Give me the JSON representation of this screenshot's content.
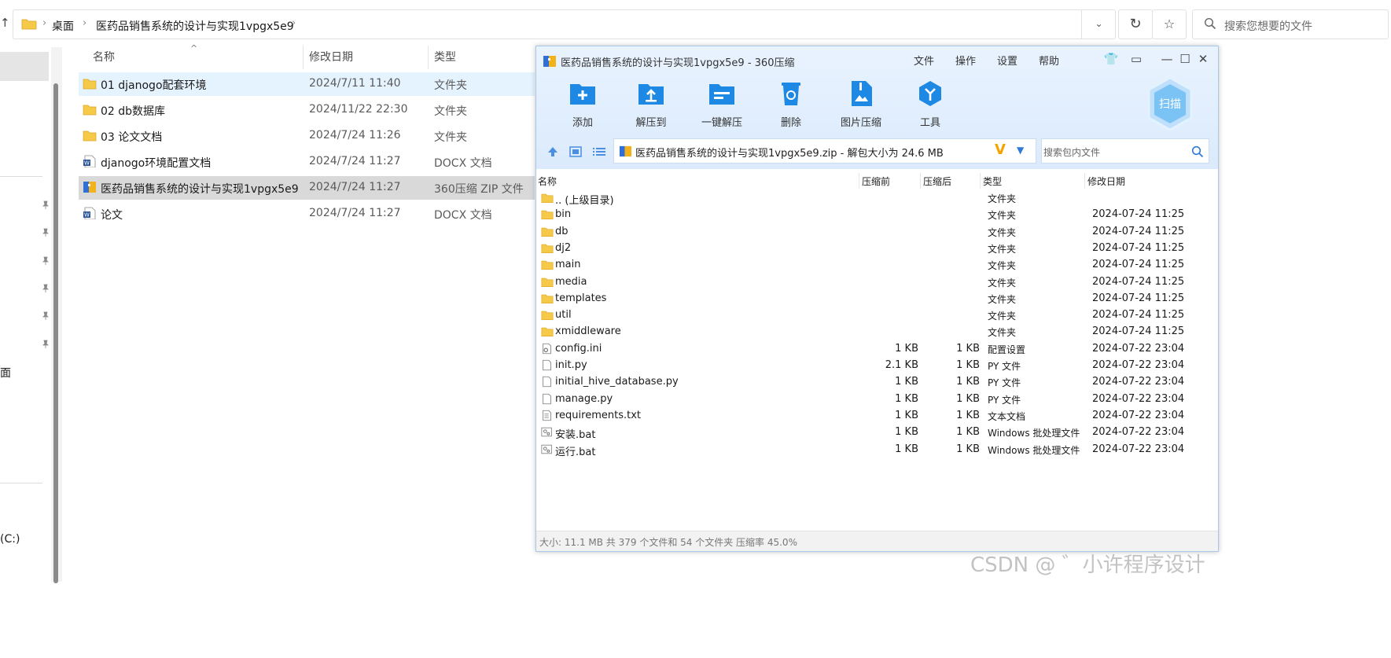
{
  "explorer": {
    "breadcrumb": [
      "桌面",
      "医药品销售系统的设计与实现1vpgx5e9"
    ],
    "search_placeholder": "搜索您想要的文件",
    "nav": {
      "item_desktop": "面",
      "item_drive": "(C:)"
    },
    "columns": {
      "name": "名称",
      "modified": "修改日期",
      "type": "类型"
    },
    "files": [
      {
        "name": "01 djanogo配套环境",
        "modified": "2024/7/11 11:40",
        "type": "文件夹",
        "icon": "folder-icon",
        "state": "hover"
      },
      {
        "name": "02 db数据库",
        "modified": "2024/11/22 22:30",
        "type": "文件夹",
        "icon": "folder-icon",
        "state": ""
      },
      {
        "name": "03 论文文档",
        "modified": "2024/7/24 11:26",
        "type": "文件夹",
        "icon": "folder-icon",
        "state": ""
      },
      {
        "name": "djanogo环境配置文档",
        "modified": "2024/7/24 11:27",
        "type": "DOCX 文档",
        "icon": "word-doc-icon",
        "state": ""
      },
      {
        "name": "医药品销售系统的设计与实现1vpgx5e9",
        "modified": "2024/7/24 11:27",
        "type": "360压缩 ZIP 文件",
        "icon": "zip-archive-icon",
        "state": "selected"
      },
      {
        "name": "论文",
        "modified": "2024/7/24 11:27",
        "type": "DOCX 文档",
        "icon": "word-doc-icon",
        "state": ""
      }
    ]
  },
  "zip": {
    "title": "医药品销售系统的设计与实现1vpgx5e9 - 360压缩",
    "menu": [
      "文件",
      "操作",
      "设置",
      "帮助"
    ],
    "tools": [
      {
        "label": "添加",
        "icon": "add-icon"
      },
      {
        "label": "解压到",
        "icon": "extract-to-icon"
      },
      {
        "label": "一键解压",
        "icon": "one-click-extract-icon"
      },
      {
        "label": "删除",
        "icon": "delete-icon"
      },
      {
        "label": "图片压缩",
        "icon": "image-compress-icon"
      },
      {
        "label": "工具",
        "icon": "tools-icon"
      }
    ],
    "scan_label": "扫描",
    "path": "医药品销售系统的设计与实现1vpgx5e9.zip - 解包大小为 24.6 MB",
    "search_placeholder": "搜索包内文件",
    "columns": {
      "name": "名称",
      "before": "压缩前",
      "after": "压缩后",
      "type": "类型",
      "modified": "修改日期"
    },
    "entries": [
      {
        "name": ".. (上级目录)",
        "before": "",
        "after": "",
        "type": "文件夹",
        "modified": "",
        "icon": "folder-icon"
      },
      {
        "name": "bin",
        "before": "",
        "after": "",
        "type": "文件夹",
        "modified": "2024-07-24 11:25",
        "icon": "folder-icon"
      },
      {
        "name": "db",
        "before": "",
        "after": "",
        "type": "文件夹",
        "modified": "2024-07-24 11:25",
        "icon": "folder-icon"
      },
      {
        "name": "dj2",
        "before": "",
        "after": "",
        "type": "文件夹",
        "modified": "2024-07-24 11:25",
        "icon": "folder-icon"
      },
      {
        "name": "main",
        "before": "",
        "after": "",
        "type": "文件夹",
        "modified": "2024-07-24 11:25",
        "icon": "folder-icon"
      },
      {
        "name": "media",
        "before": "",
        "after": "",
        "type": "文件夹",
        "modified": "2024-07-24 11:25",
        "icon": "folder-icon"
      },
      {
        "name": "templates",
        "before": "",
        "after": "",
        "type": "文件夹",
        "modified": "2024-07-24 11:25",
        "icon": "folder-icon"
      },
      {
        "name": "util",
        "before": "",
        "after": "",
        "type": "文件夹",
        "modified": "2024-07-24 11:25",
        "icon": "folder-icon"
      },
      {
        "name": "xmiddleware",
        "before": "",
        "after": "",
        "type": "文件夹",
        "modified": "2024-07-24 11:25",
        "icon": "folder-icon"
      },
      {
        "name": "config.ini",
        "before": "1 KB",
        "after": "1 KB",
        "type": "配置设置",
        "modified": "2024-07-22 23:04",
        "icon": "settings-file-icon"
      },
      {
        "name": "init.py",
        "before": "2.1 KB",
        "after": "1 KB",
        "type": "PY 文件",
        "modified": "2024-07-22 23:04",
        "icon": "file-icon"
      },
      {
        "name": "initial_hive_database.py",
        "before": "1 KB",
        "after": "1 KB",
        "type": "PY 文件",
        "modified": "2024-07-22 23:04",
        "icon": "file-icon"
      },
      {
        "name": "manage.py",
        "before": "1 KB",
        "after": "1 KB",
        "type": "PY 文件",
        "modified": "2024-07-22 23:04",
        "icon": "file-icon"
      },
      {
        "name": "requirements.txt",
        "before": "1 KB",
        "after": "1 KB",
        "type": "文本文档",
        "modified": "2024-07-22 23:04",
        "icon": "text-file-icon"
      },
      {
        "name": "安装.bat",
        "before": "1 KB",
        "after": "1 KB",
        "type": "Windows 批处理文件",
        "modified": "2024-07-22 23:04",
        "icon": "batch-file-icon"
      },
      {
        "name": "运行.bat",
        "before": "1 KB",
        "after": "1 KB",
        "type": "Windows 批处理文件",
        "modified": "2024-07-22 23:04",
        "icon": "batch-file-icon"
      }
    ],
    "status": "大小: 11.1 MB 共 379 个文件和 54 个文件夹 压缩率 45.0%"
  },
  "watermark": "CSDN @ ゛小许程序设计",
  "colors": {
    "accent": "#1e88e5",
    "folder": "#f7c948",
    "zip_header_bg": "#e9f3fe",
    "selected_row": "#d9d9d9",
    "hover_row": "#e5f3ff"
  }
}
